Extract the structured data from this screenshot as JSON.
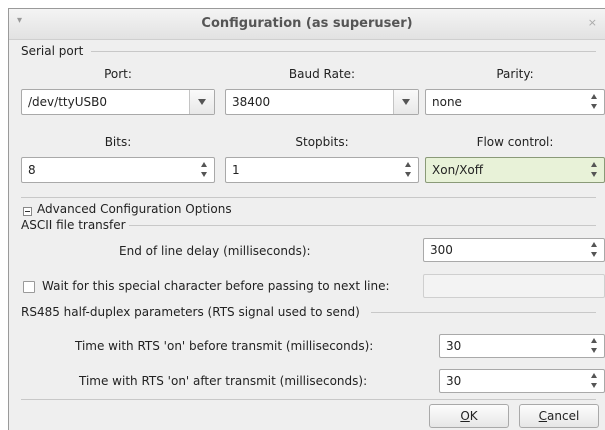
{
  "window": {
    "title": "Configuration (as superuser)",
    "close_glyph": "×",
    "menu_glyph": "▾"
  },
  "serial_port": {
    "group_label": "Serial port",
    "port_label": "Port:",
    "port_value": "/dev/ttyUSB0",
    "baud_label": "Baud Rate:",
    "baud_value": "38400",
    "parity_label": "Parity:",
    "parity_value": "none",
    "bits_label": "Bits:",
    "bits_value": "8",
    "stopbits_label": "Stopbits:",
    "stopbits_value": "1",
    "flow_label": "Flow control:",
    "flow_value": "Xon/Xoff",
    "flow_highlight_color": "#e8f2d8"
  },
  "advanced": {
    "toggle_label": "Advanced Configuration Options"
  },
  "ascii": {
    "group_label": "ASCII file transfer",
    "eol_label": "End of line delay (milliseconds):",
    "eol_value": "300",
    "wait_label": "Wait for this special character before passing to next line:",
    "wait_value": ""
  },
  "rs485": {
    "group_label": "RS485 half-duplex parameters (RTS signal used to send)",
    "before_label": "Time with RTS 'on' before transmit (milliseconds):",
    "before_value": "30",
    "after_label": "Time with RTS 'on' after transmit (milliseconds):",
    "after_value": "30"
  },
  "buttons": {
    "ok_mnemonic": "O",
    "ok_rest": "K",
    "cancel_mnemonic": "C",
    "cancel_rest": "ancel"
  }
}
